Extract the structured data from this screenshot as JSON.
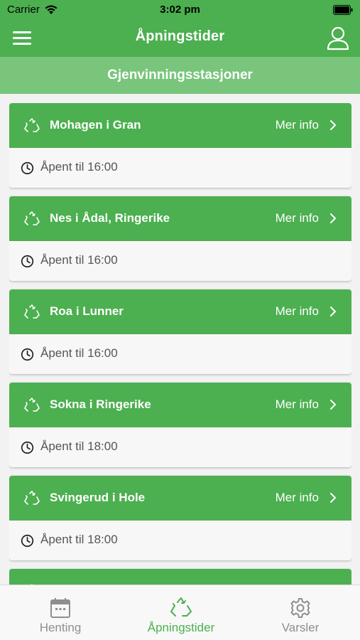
{
  "status_bar": {
    "carrier": "Carrier",
    "time": "3:02 pm"
  },
  "nav": {
    "title": "Åpningstider",
    "menu_icon": "hamburger-menu-icon",
    "profile_icon": "user-profile-icon"
  },
  "sub_header": {
    "title": "Gjenvinningsstasjoner"
  },
  "stations": [
    {
      "name": "Mohagen i Gran",
      "more_label": "Mer info",
      "hours": "Åpent til 16:00"
    },
    {
      "name": "Nes i Ådal, Ringerike",
      "more_label": "Mer info",
      "hours": "Åpent til 16:00"
    },
    {
      "name": "Roa i Lunner",
      "more_label": "Mer info",
      "hours": "Åpent til 16:00"
    },
    {
      "name": "Sokna i Ringerike",
      "more_label": "Mer info",
      "hours": "Åpent til 18:00"
    },
    {
      "name": "Svingerud i Hole",
      "more_label": "Mer info",
      "hours": "Åpent til 18:00"
    },
    {
      "name": "",
      "more_label": "",
      "hours": ""
    }
  ],
  "tabs": [
    {
      "label": "Henting",
      "icon": "calendar-icon",
      "active": false
    },
    {
      "label": "Åpningstider",
      "icon": "recycle-icon",
      "active": true
    },
    {
      "label": "Varsler",
      "icon": "gear-icon",
      "active": false
    }
  ],
  "colors": {
    "primary_green": "#4caf50",
    "light_green": "#78c57b",
    "inactive_gray": "#8e8e8e"
  }
}
